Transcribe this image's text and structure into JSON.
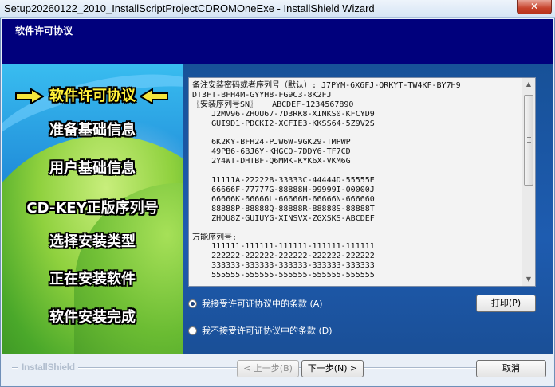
{
  "window": {
    "title": "Setup20260122_2010_InstallScriptProjectCDROMOneExe - InstallShield Wizard",
    "close_glyph": "✕"
  },
  "header": {
    "heading": "软件许可协议"
  },
  "sidebar": {
    "steps": [
      {
        "label": "软件许可协议",
        "active": true
      },
      {
        "label": "准备基础信息",
        "active": false
      },
      {
        "label": "用户基础信息",
        "active": false
      },
      {
        "label": "CD-KEY正版序列号",
        "active": false
      },
      {
        "label": "选择安装类型",
        "active": false
      },
      {
        "label": "正在安装软件",
        "active": false
      },
      {
        "label": "软件安装完成",
        "active": false
      }
    ],
    "arrow_color": "#f4e53c"
  },
  "license": {
    "lines": [
      "备注安装密码或者序列号（默认）: J7PYM-6X6FJ-QRKYT-TW4KF-BY7H9",
      "DT3FT-BFH4M-GYYH8-FG9C3-8K2FJ",
      "〖安装序列号SN〗   ABCDEF-1234567890",
      "    J2MV96-ZHOU67-7D3RK8-XINKS0-KFCYD9",
      "    GUI9D1-PDCKI2-XCFIE3-KKSS64-5Z9V2S",
      "",
      "    6K2KY-BFH24-PJW6W-9GK29-TMPWP",
      "    49PB6-6BJ6Y-KHGCQ-7DDY6-TF7CD",
      "    2Y4WT-DHTBF-Q6MMK-KYK6X-VKM6G",
      "",
      "    11111A-22222B-33333C-44444D-55555E",
      "    66666F-77777G-88888H-99999I-00000J",
      "    66666K-66666L-66666M-66666N-666660",
      "    88888P-88888Q-88888R-88888S-88888T",
      "    ZHOU8Z-GUIUYG-XINSVX-ZGXSKS-ABCDEF",
      "",
      "万能序列号:",
      "    111111-111111-111111-111111-111111",
      "    222222-222222-222222-222222-222222",
      "    333333-333333-333333-333333-333333",
      "    555555-555555-555555-555555-555555"
    ]
  },
  "options": {
    "accept_label": "我接受许可证协议中的条款 (A)",
    "decline_label": "我不接受许可证协议中的条款 (D)",
    "selected": "accept"
  },
  "buttons": {
    "print": "打印(P)",
    "back": "< 上一步(B)",
    "next": "下一步(N) >",
    "cancel": "取消"
  },
  "footer": {
    "brand": "InstallShield"
  }
}
